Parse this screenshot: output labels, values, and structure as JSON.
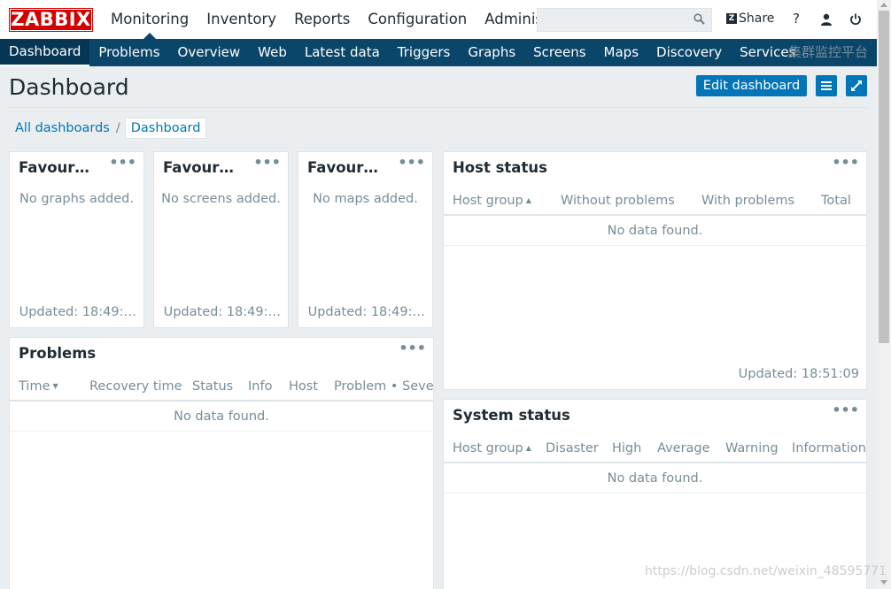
{
  "header": {
    "logo": "ZABBIX",
    "top_menu": [
      "Monitoring",
      "Inventory",
      "Reports",
      "Configuration",
      "Administra"
    ],
    "share_label": "Share",
    "help_icon": "question-icon",
    "user_icon": "user-icon",
    "logout_icon": "power-icon",
    "search_icon": "search-icon"
  },
  "submenu": {
    "items": [
      "Dashboard",
      "Problems",
      "Overview",
      "Web",
      "Latest data",
      "Triggers",
      "Graphs",
      "Screens",
      "Maps",
      "Discovery",
      "Services"
    ],
    "right_text": "集群监控平台"
  },
  "page": {
    "title": "Dashboard",
    "edit_button": "Edit dashboard"
  },
  "breadcrumb": {
    "all": "All dashboards",
    "sep": "/",
    "current": "Dashboard"
  },
  "widgets": {
    "fav_graphs": {
      "title": "Favour…",
      "empty": "No graphs added.",
      "updated": "Updated: 18:49:…"
    },
    "fav_screens": {
      "title": "Favour…",
      "empty": "No screens added.",
      "updated": "Updated: 18:49:…"
    },
    "fav_maps": {
      "title": "Favour…",
      "empty": "No maps added.",
      "updated": "Updated: 18:49:…"
    },
    "host_status": {
      "title": "Host status",
      "columns": [
        "Host group",
        "Without problems",
        "With problems",
        "Total"
      ],
      "empty": "No data found.",
      "updated": "Updated: 18:51:09"
    },
    "problems": {
      "title": "Problems",
      "columns": [
        "Time",
        "Recovery time",
        "Status",
        "Info",
        "Host",
        "Problem • Severi"
      ],
      "empty": "No data found."
    },
    "system_status": {
      "title": "System status",
      "columns": [
        "Host group",
        "Disaster",
        "High",
        "Average",
        "Warning",
        "Information"
      ],
      "empty": "No data found."
    },
    "menu_dots": "•••"
  },
  "watermark": "https://blog.csdn.net/weixin_48595771",
  "colors": {
    "logo_red": "#d40000",
    "nav_blue": "#0a466a",
    "button_blue": "#0275b8"
  }
}
